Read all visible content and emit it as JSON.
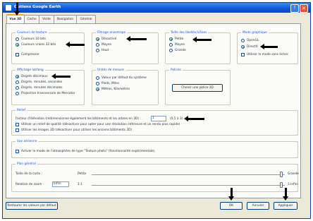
{
  "window": {
    "title": "Options Google Earth"
  },
  "tabs": [
    {
      "label": "Vue 3D"
    },
    {
      "label": "Cache"
    },
    {
      "label": "Visite"
    },
    {
      "label": "Navigation"
    },
    {
      "label": "Général"
    }
  ],
  "texture_colors": {
    "title": "Couleurs de texture",
    "opt1": "Couleurs 16 bits",
    "opt2": "Couleurs vraies 32 bits",
    "compress": "Compresser"
  },
  "anisotropic": {
    "title": "Filtrage anisotrope",
    "opt1": "Désactivé",
    "opt2": "Moyen",
    "opt3": "Haut"
  },
  "labels_size": {
    "title": "Taille des libellés/icônes",
    "opt1": "Petite",
    "opt2": "Moyen",
    "opt3": "Grande"
  },
  "graphics_mode": {
    "title": "Mode graphique",
    "opt1": "OpenGL",
    "opt2": "DirectX",
    "safe_mode": "Utiliser le mode sans échec"
  },
  "latlong": {
    "title": "Affichage lat/long",
    "opt1": "Degrés décimaux",
    "opt2": "Degrés, minutes, secondes",
    "opt3": "Degrés, minutes décimales",
    "opt4": "Projection transversale de Mercator"
  },
  "units": {
    "title": "Unités de mesure",
    "opt1": "Valeur par défaut du système",
    "opt2": "Pieds, Miles",
    "opt3": "Mètres, Kilomètres"
  },
  "fonts": {
    "title": "Polices",
    "button": "Choisir une police 3D"
  },
  "terrain": {
    "title": "Relief",
    "elevation_label": "Facteur d'élévation (redimensionne également les bâtiments et les arbres en 3D) :",
    "elevation_value": "1",
    "elevation_range": "(0,5 à 3)",
    "hq_check": "Utiliser un relief de qualité (désactiver pour opter pour une résolution inférieure et un rendu plus rapide)",
    "buildings3d_check": "Utiliser les images 3D (désactiver pour utiliser les anciens bâtiments 3D)"
  },
  "overview": {
    "title": "Vue aérienne",
    "check": "Activer le mode de l'atmosphère de type \"Texture photo\" (fonctionnalité expérimentale)"
  },
  "overview_map": {
    "title": "Plan général",
    "map_size_label": "Taille de la carte :",
    "map_size_min": "Petite",
    "map_size_max": "Grande",
    "zoom_label": "Relation de zoom :",
    "zoom_value": "Infini",
    "zoom_min": "1:1",
    "zoom_max": "1:infini",
    "map_size_level": 0.98,
    "zoom_level": 0.98
  },
  "footer": {
    "restore": "Restaurer les valeurs par défaut",
    "ok": "OK",
    "cancel": "Annuler",
    "apply": "Appliquer"
  },
  "colors": {
    "title_bar": "#0b56d8",
    "group_title": "#1c4fd0",
    "window_bg": "#ece9d8",
    "annotation_arrow": "#000000"
  }
}
